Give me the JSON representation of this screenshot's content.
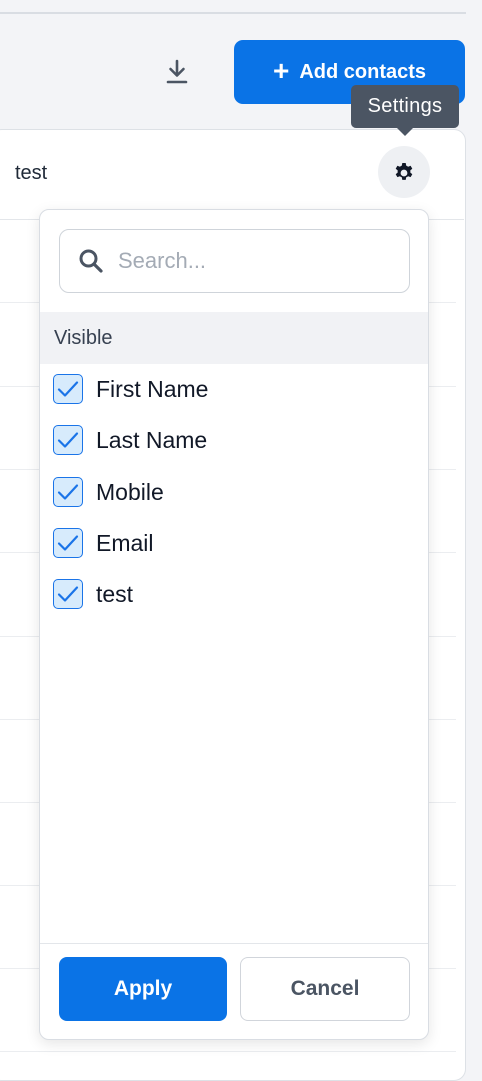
{
  "toolbar": {
    "download_icon": "download-icon",
    "add_contacts_label": "Add contacts",
    "add_icon": "plus-icon"
  },
  "tooltip": {
    "text": "Settings"
  },
  "table": {
    "column_header": "test",
    "settings_icon": "gear-icon"
  },
  "column_picker": {
    "search_placeholder": "Search...",
    "section_title": "Visible",
    "options": [
      {
        "label": "First Name",
        "checked": true
      },
      {
        "label": "Last Name",
        "checked": true
      },
      {
        "label": "Mobile",
        "checked": true
      },
      {
        "label": "Email",
        "checked": true
      },
      {
        "label": "test",
        "checked": true
      }
    ],
    "apply_label": "Apply",
    "cancel_label": "Cancel"
  },
  "colors": {
    "primary": "#0a73e6",
    "tooltip_bg": "#4b5563",
    "checkbox_fill": "#d7ebfc"
  }
}
